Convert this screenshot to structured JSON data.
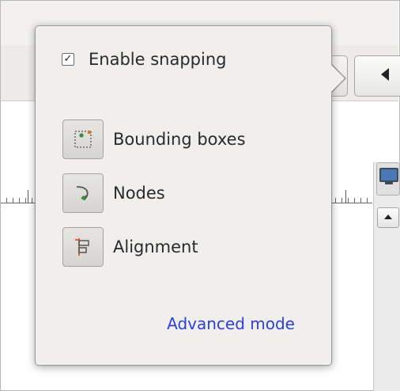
{
  "popover": {
    "enable_snapping": {
      "label": "Enable snapping",
      "checked": true,
      "check_glyph": "✓"
    },
    "snap_targets": [
      {
        "label": "Bounding boxes",
        "icon": "bounding-box-icon",
        "active": true
      },
      {
        "label": "Nodes",
        "icon": "node-icon",
        "active": true
      },
      {
        "label": "Alignment",
        "icon": "alignment-icon",
        "active": true
      }
    ],
    "advanced_link": "Advanced mode"
  },
  "colors": {
    "link": "#2d3fd4",
    "popover_bg": "#f0efed",
    "node_green": "#3a8a3a",
    "alignment_red": "#d04a2a"
  }
}
